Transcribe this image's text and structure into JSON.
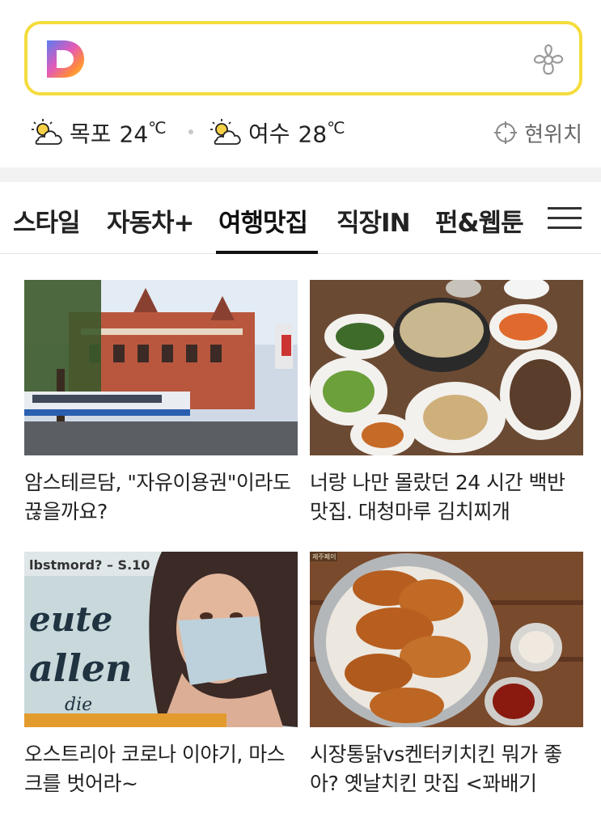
{
  "search": {
    "logo_icon": "daum-d-logo-icon",
    "flower_icon": "flower-icon",
    "border_color": "#f4dc3c"
  },
  "weather": {
    "items": [
      {
        "city": "목포",
        "temp": "24",
        "unit": "℃",
        "icon": "partly-sunny-icon"
      },
      {
        "city": "여수",
        "temp": "28",
        "unit": "℃",
        "icon": "partly-sunny-icon"
      }
    ],
    "location_label": "현위치",
    "location_icon": "crosshair-icon"
  },
  "tabs": {
    "items": [
      "스타일",
      "자동차+",
      "여행맛집",
      "직장IN",
      "펀&웹툰"
    ],
    "active": "여행맛집",
    "menu_icon": "hamburger-menu-icon"
  },
  "cards": [
    {
      "title": "암스테르담, \"자유이용권\"이라도 끊을까요?",
      "image": "amsterdam-theater-photo"
    },
    {
      "title": "너랑 나만 몰랐던 24 시간 백반 맛집. 대청마루 김치찌개",
      "image": "korean-meal-photo"
    },
    {
      "title": "오스트리아 코로나 이야기, 마스크를 벗어라~",
      "image": "magazine-mask-photo"
    },
    {
      "title": "시장통닭vs켄터키치킨 뭐가 좋아? 옛날치킨 맛집 <꽈배기",
      "image": "fried-chicken-photo"
    }
  ]
}
